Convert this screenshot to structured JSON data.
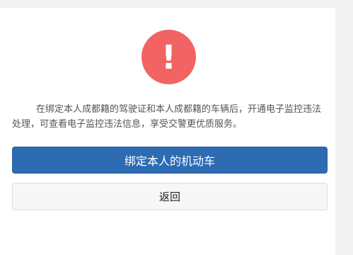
{
  "alert": {
    "icon": "exclamation-icon",
    "symbol": "!",
    "color": "#f26363"
  },
  "description": "在绑定本人成都籍的驾驶证和本人成都籍的车辆后，开通电子监控违法处理，可查看电子监控违法信息，享受交警更优质服务。",
  "buttons": {
    "bind_label": "绑定本人的机动车",
    "back_label": "返回"
  },
  "colors": {
    "primary": "#2d6bb3",
    "secondary_bg": "#f7f7f7",
    "page_bg": "#f2f2f2"
  }
}
